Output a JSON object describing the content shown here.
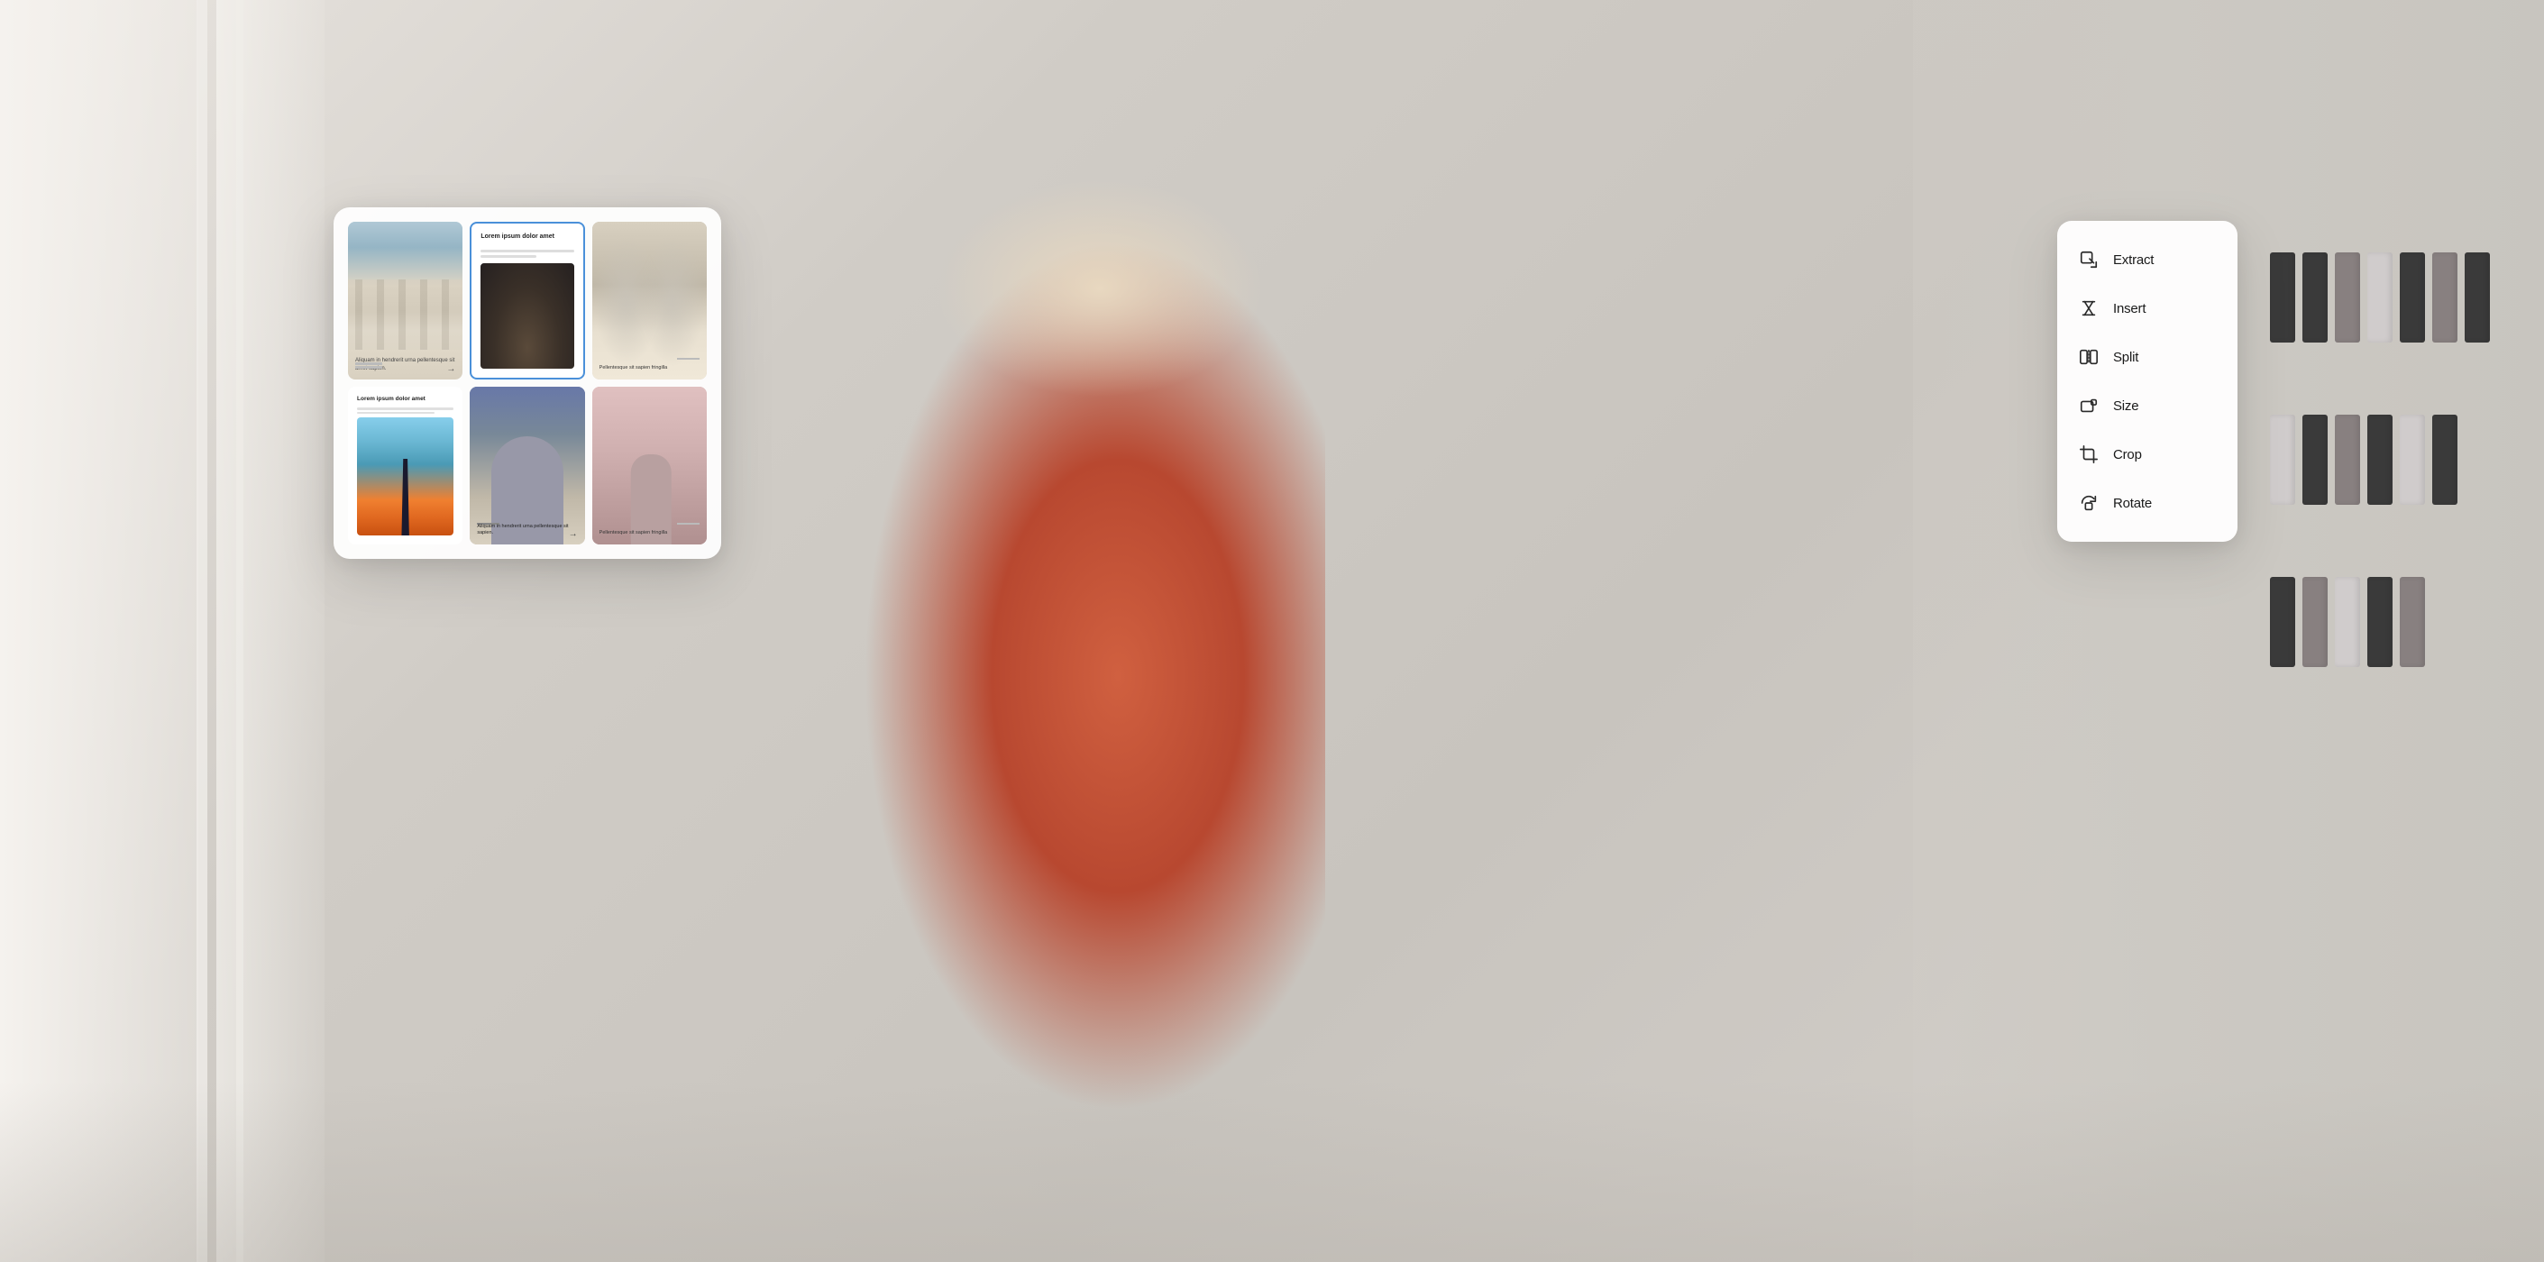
{
  "background": {
    "color": "#d8d5d0"
  },
  "floating_panel": {
    "cells": [
      {
        "id": "cell-1",
        "type": "image-text",
        "image_description": "architectural columns with sky",
        "text": "Aliquam in hendrerit urna pellentesque sit amet sapien.",
        "arrow": "→"
      },
      {
        "id": "cell-2",
        "type": "text-image",
        "title": "Lorem ipsum dolor amet",
        "image_description": "dark angular architecture",
        "has_border": true,
        "border_color": "#4a90d9"
      },
      {
        "id": "cell-3",
        "type": "image-text",
        "image_description": "gothic cathedral interior arches",
        "text": "Pellentesque sit sapien fringilla"
      },
      {
        "id": "cell-4",
        "type": "text-image",
        "title": "Lorem ipsum dolor amet",
        "image_description": "lighthouse at sunset"
      },
      {
        "id": "cell-5",
        "type": "image-text",
        "image_description": "curved modern building",
        "text": "Aliquam in hendrerit urna pellentesque sit sapien.",
        "arrow": "→"
      },
      {
        "id": "cell-6",
        "type": "image-text",
        "image_description": "pink tower building",
        "text": "Pellentesque sit sapien fringilla"
      }
    ]
  },
  "context_menu": {
    "items": [
      {
        "id": "extract",
        "label": "Extract",
        "icon": "extract-icon"
      },
      {
        "id": "insert",
        "label": "Insert",
        "icon": "insert-icon"
      },
      {
        "id": "split",
        "label": "Split",
        "icon": "split-icon"
      },
      {
        "id": "size",
        "label": "Size",
        "icon": "size-icon"
      },
      {
        "id": "crop",
        "label": "Crop",
        "icon": "crop-icon"
      },
      {
        "id": "rotate",
        "label": "Rotate",
        "icon": "rotate-icon"
      }
    ]
  }
}
